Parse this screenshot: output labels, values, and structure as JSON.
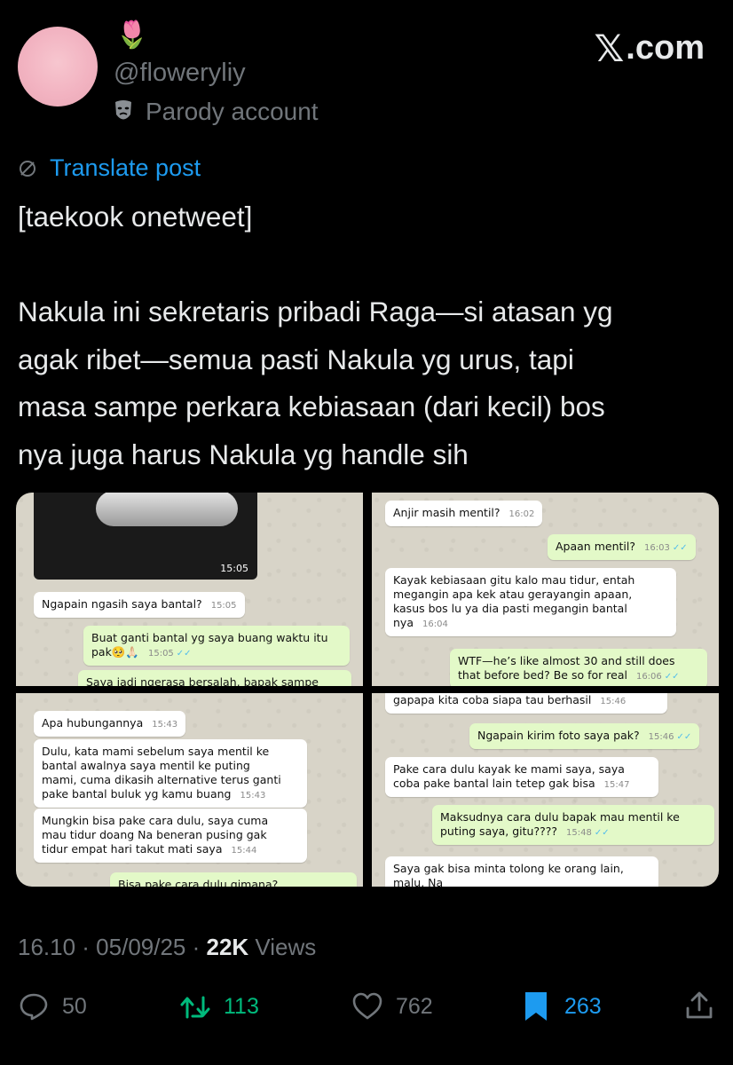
{
  "header": {
    "emoji": "🌷",
    "handle": "@floweryliy",
    "parody_label": "Parody account",
    "brand": ".com"
  },
  "translate_label": "Translate post",
  "tweet_text": "[taekook onetweet]\n\nNakula ini sekretaris pribadi Raga—si atasan yg\nagak ribet—semua pasti Nakula yg urus, tapi\nmasa sampe perkara kebiasaan (dari kecil) bos\nnya juga harus Nakula yg handle sih",
  "chats": {
    "p1": {
      "photo_time": "15:05",
      "m1": "Ngapain ngasih saya bantal?",
      "m1_time": "15:05",
      "m2": "Buat ganti bantal yg saya buang waktu itu\npak🥺🙏🏻",
      "m2_time": "15:05",
      "m3": "Saya jadi ngerasa bersalah, bapak sampe"
    },
    "p2": {
      "m1": "Anjir masih mentil?",
      "m1_time": "16:02",
      "m2": "Apaan mentil?",
      "m2_time": "16:03",
      "m3": "Kayak kebiasaan gitu kalo mau tidur, entah\nmegangin apa kek atau gerayangin apaan,\nkasus bos lu ya dia pasti megangin bantal\nnya",
      "m3_time": "16:04",
      "m4": "WTF—he’s like almost 30 and still does\nthat before bed? Be so for real",
      "m4_time": "16:06"
    },
    "p3": {
      "m1": "Apa hubungannya",
      "m1_time": "15:43",
      "m2": "Dulu, kata mami sebelum saya mentil ke\nbantal awalnya saya mentil ke puting\nmami, cuma dikasih alternative terus ganti\npake bantal buluk yg kamu buang",
      "m2_time": "15:43",
      "m3": "Mungkin bisa pake cara dulu, saya cuma\nmau tidur doang Na beneran pusing gak\ntidur empat hari takut mati saya",
      "m3_time": "15:44",
      "m4": "Bisa pake cara dulu gimana?"
    },
    "p4": {
      "m0": "gapapa kita coba siapa tau berhasil",
      "m0_time": "15:46",
      "m1": "Ngapain kirim foto saya pak?",
      "m1_time": "15:46",
      "m2": "Pake cara dulu kayak ke mami saya, saya\ncoba pake bantal lain tetep gak bisa",
      "m2_time": "15:47",
      "m3": "Maksudnya cara dulu bapak mau mentil ke\nputing saya, gitu????",
      "m3_time": "15:48",
      "m4": "Saya gak bisa minta tolong ke orang lain,\nmalu, Na"
    }
  },
  "meta": {
    "timestamp": "16.10 · 05/09/25 · ",
    "views_count": "22K",
    "views_label": " Views"
  },
  "actions": {
    "replies": "50",
    "reposts": "113",
    "likes": "762",
    "bookmarks": "263"
  },
  "colors": {
    "accent": "#1d9bf0",
    "repost": "#00ba7c",
    "muted": "#71767b"
  }
}
